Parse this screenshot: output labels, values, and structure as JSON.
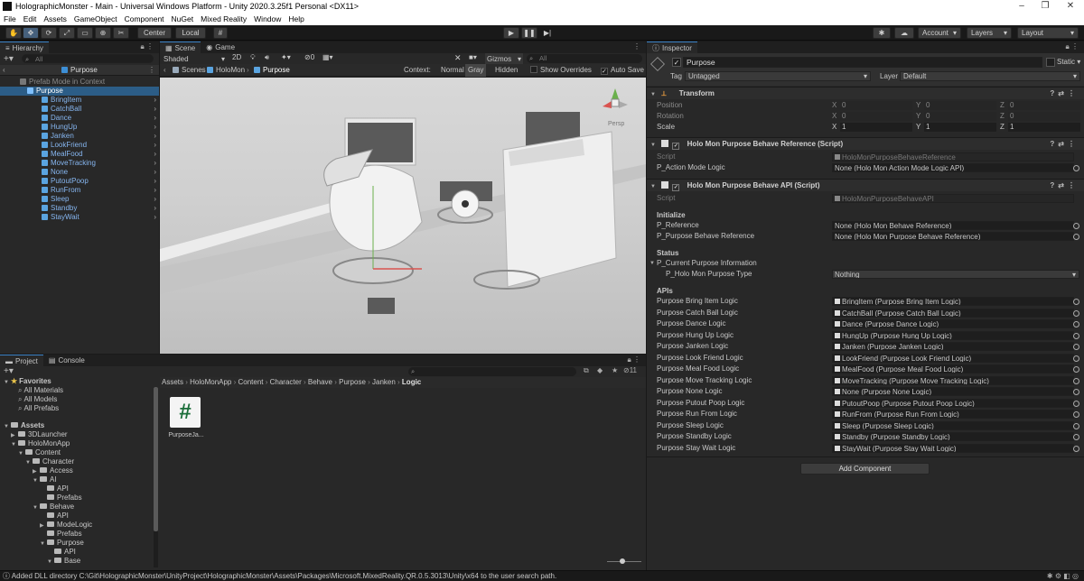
{
  "window": {
    "title": "HolographicMonster - Main - Universal Windows Platform - Unity 2020.3.25f1 Personal <DX11>"
  },
  "menu": [
    "File",
    "Edit",
    "Assets",
    "GameObject",
    "Component",
    "NuGet",
    "Mixed Reality",
    "Window",
    "Help"
  ],
  "toolbar": {
    "pivot_label": "Center",
    "space_label": "Local",
    "account_label": "Account",
    "layers_label": "Layers",
    "layout_label": "Layout"
  },
  "hierarchy": {
    "tab": "Hierarchy",
    "search_placeholder": "All",
    "root": "Purpose",
    "prefab_mode": "Prefab Mode in Context",
    "selected": "Purpose",
    "children": [
      "BringItem",
      "CatchBall",
      "Dance",
      "HungUp",
      "Janken",
      "LookFriend",
      "MealFood",
      "MoveTracking",
      "None",
      "PutoutPoop",
      "RunFrom",
      "Sleep",
      "Standby",
      "StayWait"
    ]
  },
  "scene": {
    "tabs": [
      "Scene",
      "Game"
    ],
    "shading": "Shaded",
    "mode_2d": "2D",
    "hidden_count": "0",
    "gizmos": "Gizmos",
    "search_placeholder": "All",
    "breadcrumbs": [
      "Scenes",
      "HoloMon",
      "Purpose"
    ],
    "context_label": "Context:",
    "context_options": [
      "Normal",
      "Gray",
      "Hidden"
    ],
    "show_overrides": "Show Overrides",
    "auto_save": "Auto Save",
    "persp_label": "Persp"
  },
  "project": {
    "tabs": [
      "Project",
      "Console"
    ],
    "badge_count": "11",
    "favorites_label": "Favorites",
    "favorites": [
      "All Materials",
      "All Models",
      "All Prefabs"
    ],
    "assets_label": "Assets",
    "tree": [
      {
        "label": "3DLauncher",
        "depth": 1,
        "open": false
      },
      {
        "label": "HoloMonApp",
        "depth": 1,
        "open": true
      },
      {
        "label": "Content",
        "depth": 2,
        "open": true
      },
      {
        "label": "Character",
        "depth": 3,
        "open": true
      },
      {
        "label": "Access",
        "depth": 4,
        "open": false
      },
      {
        "label": "AI",
        "depth": 4,
        "open": true
      },
      {
        "label": "API",
        "depth": 5,
        "open": null
      },
      {
        "label": "Prefabs",
        "depth": 5,
        "open": null
      },
      {
        "label": "Behave",
        "depth": 4,
        "open": true
      },
      {
        "label": "API",
        "depth": 5,
        "open": null
      },
      {
        "label": "ModeLogic",
        "depth": 5,
        "open": false
      },
      {
        "label": "Prefabs",
        "depth": 5,
        "open": null
      },
      {
        "label": "Purpose",
        "depth": 5,
        "open": true
      },
      {
        "label": "API",
        "depth": 6,
        "open": null
      },
      {
        "label": "Base",
        "depth": 6,
        "open": true
      }
    ],
    "breadcrumbs": [
      "Assets",
      "HoloMonApp",
      "Content",
      "Character",
      "Behave",
      "Purpose",
      "Janken",
      "Logic"
    ],
    "file_name": "PurposeJa..."
  },
  "inspector": {
    "tab": "Inspector",
    "object_name": "Purpose",
    "static_label": "Static",
    "tag_label": "Tag",
    "tag_value": "Untagged",
    "layer_label": "Layer",
    "layer_value": "Default",
    "transform": {
      "title": "Transform",
      "position_label": "Position",
      "rotation_label": "Rotation",
      "scale_label": "Scale",
      "position": [
        "0",
        "0",
        "0"
      ],
      "rotation": [
        "0",
        "0",
        "0"
      ],
      "scale": [
        "1",
        "1",
        "1"
      ]
    },
    "comp1": {
      "title": "Holo Mon Purpose Behave Reference (Script)",
      "script_label": "Script",
      "script_value": "HoloMonPurposeBehaveReference",
      "field_label": "P_Action Mode Logic",
      "field_value": "None (Holo Mon Action Mode Logic API)"
    },
    "comp2": {
      "title": "Holo Mon Purpose Behave API (Script)",
      "script_label": "Script",
      "script_value": "HoloMonPurposeBehaveAPI",
      "initialize_label": "Initialize",
      "reference_label": "P_Reference",
      "reference_value": "None (Holo Mon Behave Reference)",
      "purpose_ref_label": "P_Purpose Behave Reference",
      "purpose_ref_value": "None (Holo Mon Purpose Behave Reference)",
      "status_label": "Status",
      "current_info_label": "P_Current Purpose Information",
      "purpose_type_label": "P_Holo Mon Purpose Type",
      "purpose_type_value": "Nothing",
      "apis_label": "APIs",
      "apis": [
        {
          "label": "Purpose Bring Item Logic",
          "value": "BringItem (Purpose Bring Item Logic)"
        },
        {
          "label": "Purpose Catch Ball Logic",
          "value": "CatchBall (Purpose Catch Ball Logic)"
        },
        {
          "label": "Purpose Dance Logic",
          "value": "Dance (Purpose Dance Logic)"
        },
        {
          "label": "Purpose Hung Up Logic",
          "value": "HungUp (Purpose Hung Up Logic)"
        },
        {
          "label": "Purpose Janken Logic",
          "value": "Janken (Purpose Janken Logic)"
        },
        {
          "label": "Purpose Look Friend Logic",
          "value": "LookFriend (Purpose Look Friend Logic)"
        },
        {
          "label": "Purpose Meal Food Logic",
          "value": "MealFood (Purpose Meal Food Logic)"
        },
        {
          "label": "Purpose Move Tracking Logic",
          "value": "MoveTracking (Purpose Move Tracking Logic)"
        },
        {
          "label": "Purpose None Logic",
          "value": "None (Purpose None Logic)"
        },
        {
          "label": "Purpose Putout Poop Logic",
          "value": "PutoutPoop (Purpose Putout Poop Logic)"
        },
        {
          "label": "Purpose Run From Logic",
          "value": "RunFrom (Purpose Run From Logic)"
        },
        {
          "label": "Purpose Sleep Logic",
          "value": "Sleep (Purpose Sleep Logic)"
        },
        {
          "label": "Purpose Standby Logic",
          "value": "Standby (Purpose Standby Logic)"
        },
        {
          "label": "Purpose Stay Wait Logic",
          "value": "StayWait (Purpose Stay Wait Logic)"
        }
      ]
    },
    "add_component": "Add Component"
  },
  "status": {
    "message": "Added DLL directory C:\\Git\\HolographicMonster\\UnityProject\\HolographicMonster\\Assets\\Packages\\Microsoft.MixedReality.QR.0.5.3013\\Unity\\x64 to the user search path."
  },
  "colors": {
    "accent_blue": "#3b82c6",
    "selection": "#2c5d87",
    "prefab_text": "#86b6f0"
  }
}
